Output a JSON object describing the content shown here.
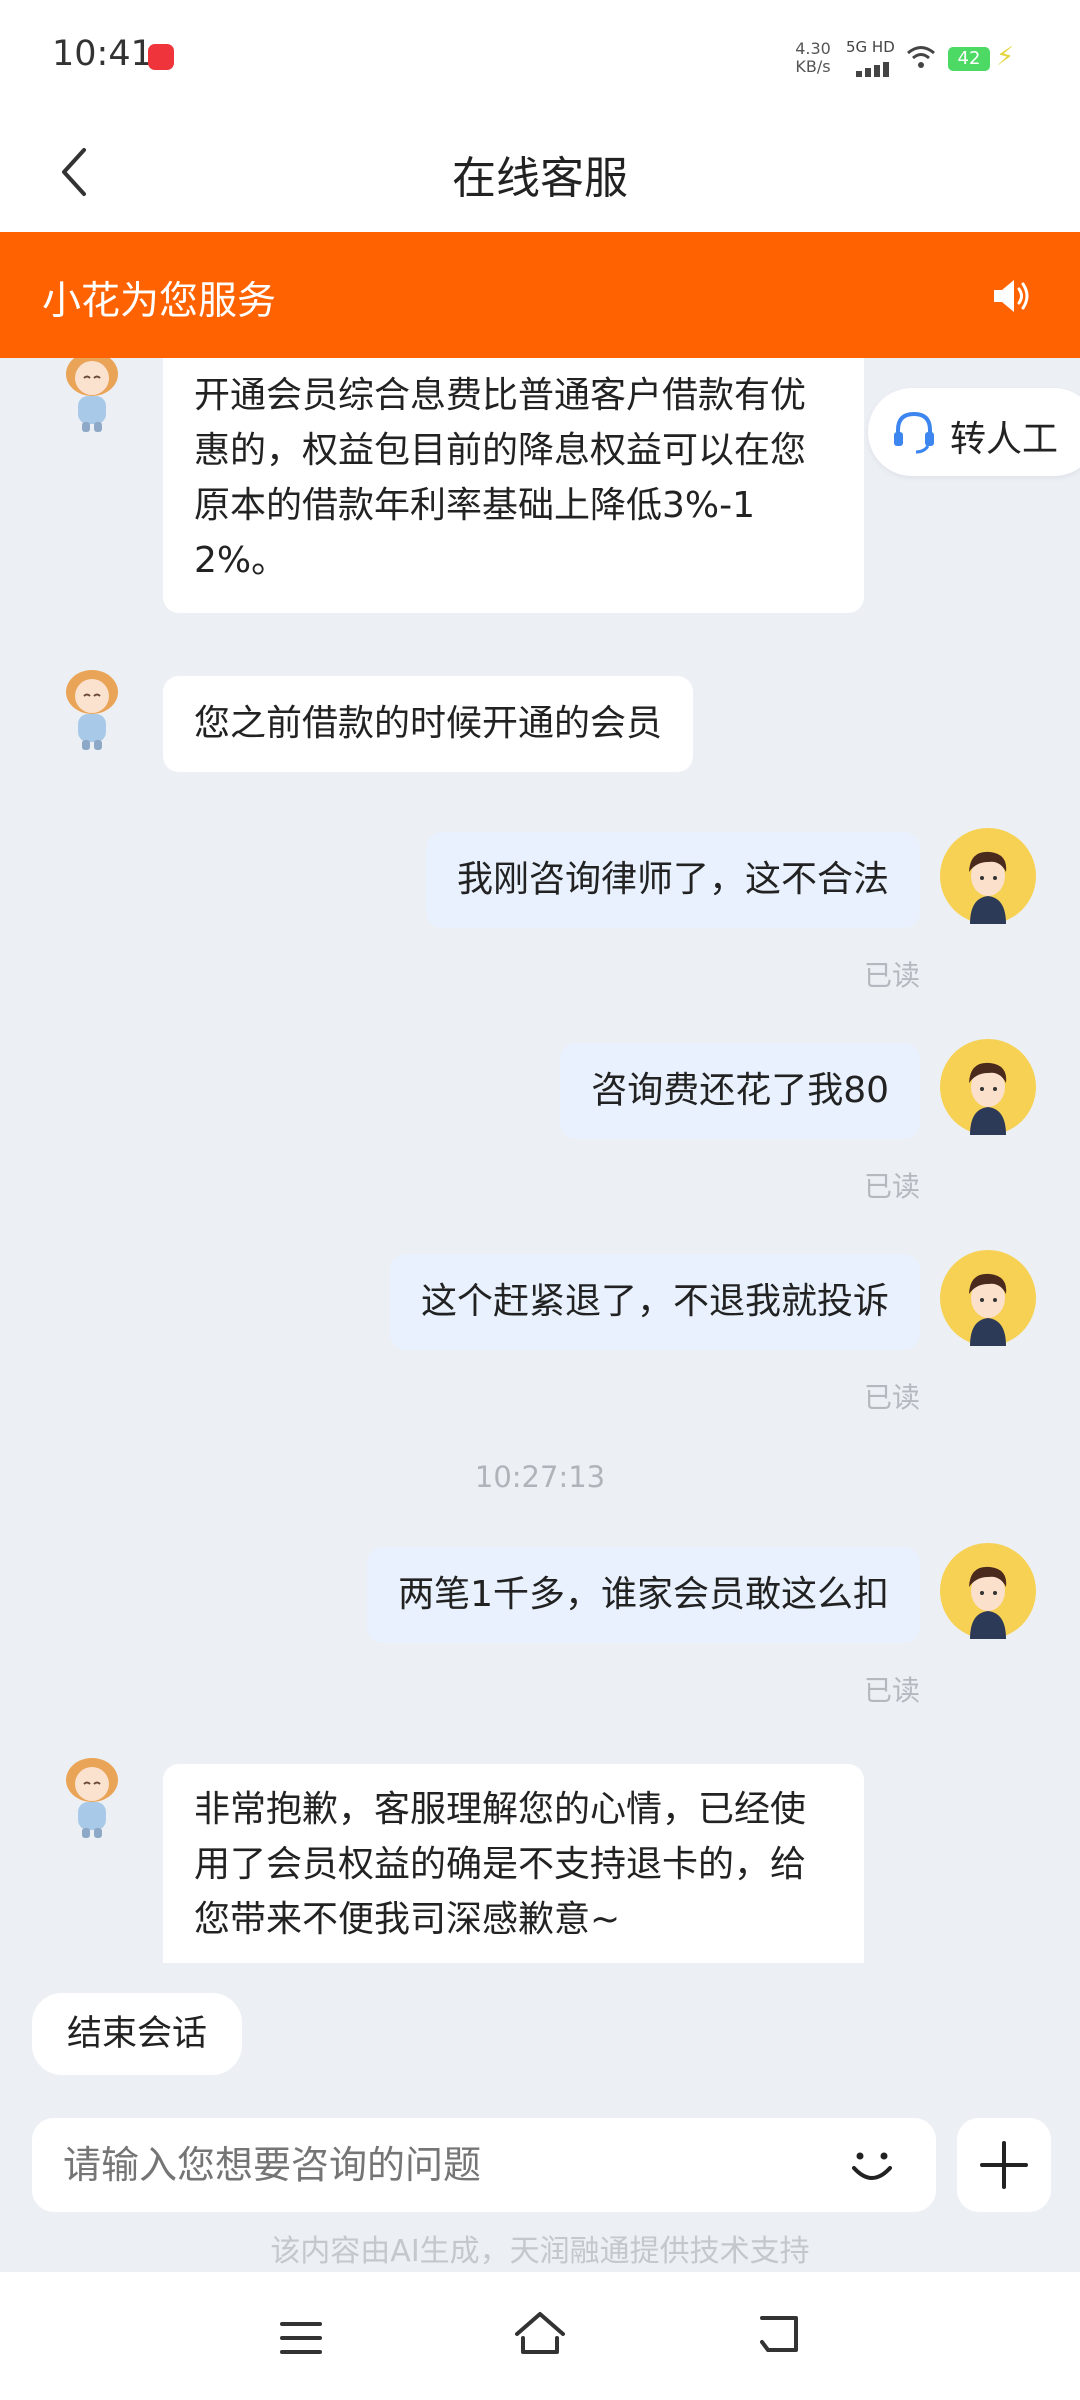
{
  "status_bar": {
    "time": "10:41",
    "net_speed_value": "4.30",
    "net_speed_unit": "KB/s",
    "network": "5G HD",
    "battery": "42"
  },
  "header": {
    "title": "在线客服"
  },
  "banner": {
    "title": "小花为您服务"
  },
  "transfer": {
    "label": "转人工"
  },
  "messages": [
    {
      "side": "agent",
      "lines": [
        "开通会员综合息费比普通客户借款有优",
        "惠的，权益包目前的降息权益可以在您",
        "原本的借款年利率基础上降低3%-1",
        "2%。"
      ]
    },
    {
      "side": "agent",
      "lines": [
        "您之前借款的时候开通的会员"
      ]
    },
    {
      "side": "user",
      "text": "我刚咨询律师了，这不合法",
      "status": "已读"
    },
    {
      "side": "user",
      "text": "咨询费还花了我80",
      "status": "已读"
    },
    {
      "side": "user",
      "text": "这个赶紧退了，不退我就投诉",
      "status": "已读"
    },
    {
      "side": "user",
      "text": "两笔1千多，谁家会员敢这么扣",
      "status": "已读"
    },
    {
      "side": "agent",
      "lines": [
        "非常抱歉，客服理解您的心情，已经使",
        "用了会员权益的确是不支持退卡的，给",
        "您带来不便我司深感歉意~"
      ]
    }
  ],
  "timestamp": "10:27:13",
  "end_session": "结束会话",
  "input": {
    "placeholder": "请输入您想要咨询的问题"
  },
  "disclaimer": "该内容由AI生成，天润融通提供技术支持",
  "colors": {
    "brand": "#ff6200",
    "chat_bg": "#ecf0f5",
    "user_bubble": "#e8f1fd"
  }
}
